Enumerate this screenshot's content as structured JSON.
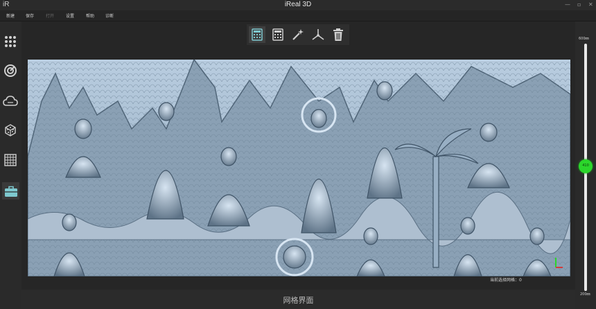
{
  "window": {
    "logo": "iR",
    "title": "iReal 3D",
    "controls": [
      "—",
      "▫",
      "✕"
    ]
  },
  "menu": [
    {
      "label": "新建",
      "enabled": true
    },
    {
      "label": "保存",
      "enabled": true
    },
    {
      "label": "打开",
      "enabled": false
    },
    {
      "label": "设置",
      "enabled": true
    },
    {
      "label": "帮助",
      "enabled": true
    },
    {
      "label": "诊断",
      "enabled": true
    }
  ],
  "sidebar_icons": [
    "grid-dots-icon",
    "scan-dial-icon",
    "cloud-icon",
    "point-cube-icon",
    "mesh-grid-icon",
    "toolbox-icon"
  ],
  "flyout_icons": [
    "magnify-search-icon",
    "eye-target-icon"
  ],
  "toolbar_icons": [
    "calculator-icon",
    "calculator-2-icon",
    "magic-wand-icon",
    "axis-tripod-icon",
    "trash-icon"
  ],
  "status": {
    "text": "当前选择网格：0"
  },
  "page_title": "网格界面",
  "slider": {
    "max_label": "600㎜",
    "min_label": "200㎜",
    "value_label": "410",
    "value": 410
  },
  "colors": {
    "accent_green": "#2bd62b",
    "flyout_red": "#d33a3a",
    "mesh": "#9fb4c8",
    "toolbar_teal": "#7ec9cf"
  }
}
